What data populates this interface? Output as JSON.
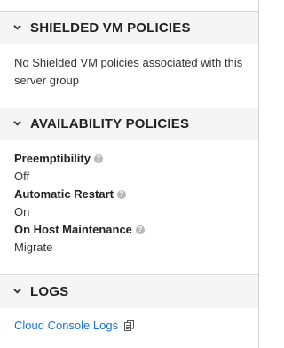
{
  "sections": {
    "shielded_vm": {
      "title": "SHIELDED VM POLICIES",
      "message": "No Shielded VM policies associated with this server group"
    },
    "availability": {
      "title": "AVAILABILITY POLICIES",
      "properties": [
        {
          "label": "Preemptibility",
          "value": "Off"
        },
        {
          "label": "Automatic Restart",
          "value": "On"
        },
        {
          "label": "On Host Maintenance",
          "value": "Migrate"
        }
      ]
    },
    "logs": {
      "title": "LOGS",
      "link_label": "Cloud Console Logs"
    }
  },
  "icons": {
    "section_toggle": "chevron-down-icon",
    "property_help": "question-circle-icon",
    "copy": "clipboard-icon"
  },
  "colors": {
    "header_background": "#f5f5f5",
    "link": "#1a73c9",
    "help_icon": "#b8b8b8"
  }
}
